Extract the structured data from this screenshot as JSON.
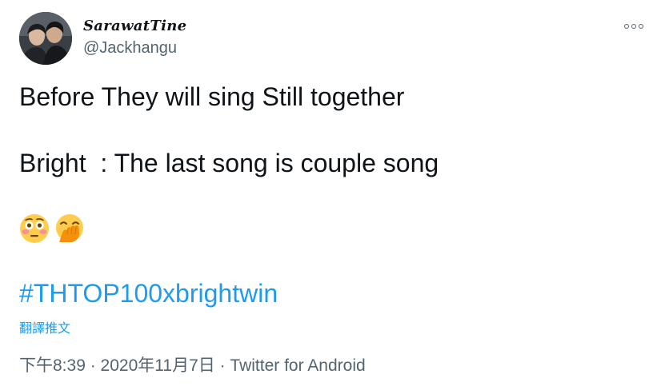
{
  "tweet": {
    "display_name": "SarawatTine",
    "handle": "@Jackhangu",
    "more_icon": "more-horizontal-icon",
    "text_lines": [
      "Before They will sing Still together",
      "Bright  : The last song is couple song"
    ],
    "emojis": [
      "flushed-face",
      "face-with-hand-over-mouth"
    ],
    "hashtag": "#THTOP100xbrightwin",
    "translate_label": "翻譯推文",
    "time": "下午8:39",
    "separator": " · ",
    "date": "2020年11月7日",
    "source": "Twitter for Android"
  },
  "colors": {
    "text": "#0f1419",
    "secondary": "#536471",
    "link": "#1d9bf0"
  }
}
